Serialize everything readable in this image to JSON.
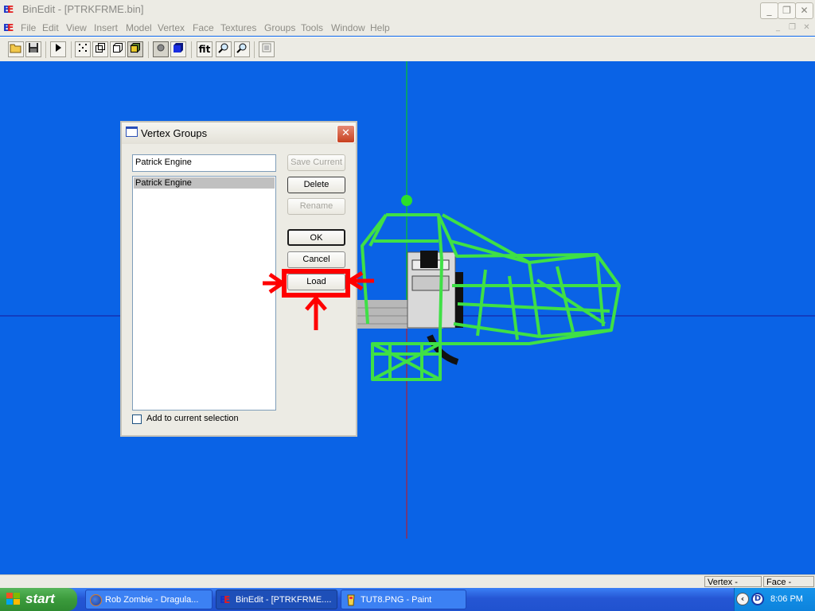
{
  "window": {
    "title": "BinEdit - [PTRKFRME.bin]",
    "app_icon": "binedit-logo",
    "minimize": "_",
    "restore": "❐",
    "close": "✕"
  },
  "menu": {
    "items": [
      "File",
      "Edit",
      "View",
      "Insert",
      "Model",
      "Vertex",
      "Face",
      "Textures",
      "Groups",
      "Tools",
      "Window",
      "Help"
    ],
    "mdi_min": "_",
    "mdi_restore": "❐",
    "mdi_close": "✕"
  },
  "toolbar": {
    "fit_label": "fit"
  },
  "dialog": {
    "title": "Vertex Groups",
    "name_value": "Patrick Engine",
    "list_items": [
      "Patrick Engine"
    ],
    "buttons": {
      "save_current": "Save Current",
      "delete": "Delete",
      "rename": "Rename",
      "ok": "OK",
      "cancel": "Cancel",
      "load": "Load"
    },
    "checkbox_label": "Add to current selection",
    "checkbox_checked": false
  },
  "status": {
    "vertex": "Vertex - None",
    "face": "Face - None"
  },
  "taskbar": {
    "start": "start",
    "tasks": [
      {
        "label": "Rob Zombie - Dragula...",
        "icon": "firefox-icon"
      },
      {
        "label": "BinEdit - [PTRKFRME....",
        "icon": "binedit-icon"
      },
      {
        "label": "TUT8.PNG - Paint",
        "icon": "paint-icon"
      }
    ],
    "clock": "8:06 PM"
  },
  "colors": {
    "viewport_bg": "#0a63e6",
    "wireframe": "#3fe046",
    "annotation": "#ff0000"
  }
}
